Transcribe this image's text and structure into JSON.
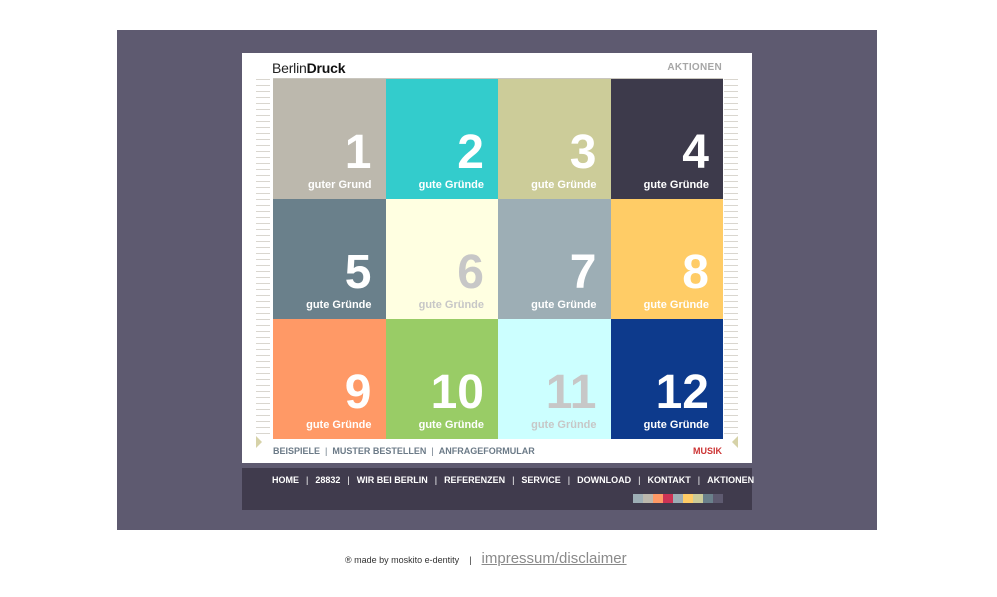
{
  "header": {
    "logo_light": "Berlin",
    "logo_bold": "Druck",
    "top_right_link": "AKTIONEN"
  },
  "tiles": [
    {
      "number": "1",
      "label": "guter Grund",
      "bg": "#bcb8ad",
      "text_color": "#ffffff"
    },
    {
      "number": "2",
      "label": "gute Gründe",
      "bg": "#33cccc",
      "text_color": "#ffffff"
    },
    {
      "number": "3",
      "label": "gute Gründe",
      "bg": "#cccc99",
      "text_color": "#ffffff"
    },
    {
      "number": "4",
      "label": "gute Gründe",
      "bg": "#3d3a4b",
      "text_color": "#ffffff"
    },
    {
      "number": "5",
      "label": "gute Gründe",
      "bg": "#6a808b",
      "text_color": "#ffffff"
    },
    {
      "number": "6",
      "label": "gute Gründe",
      "bg": "#ffffe1",
      "text_color": "#c7c7c7"
    },
    {
      "number": "7",
      "label": "gute Gründe",
      "bg": "#9daeb5",
      "text_color": "#ffffff"
    },
    {
      "number": "8",
      "label": "gute Gründe",
      "bg": "#ffcc66",
      "text_color": "#ffffff"
    },
    {
      "number": "9",
      "label": "gute Gründe",
      "bg": "#ff9966",
      "text_color": "#ffffff"
    },
    {
      "number": "10",
      "label": "gute Gründe",
      "bg": "#99cc66",
      "text_color": "#ffffff"
    },
    {
      "number": "11",
      "label": "gute Gründe",
      "bg": "#ccffff",
      "text_color": "#c7c7c7"
    },
    {
      "number": "12",
      "label": "gute Gründe",
      "bg": "#0d3a8c",
      "text_color": "#ffffff"
    }
  ],
  "subnav": {
    "items": [
      "BEISPIELE",
      "MUSTER BESTELLEN",
      "ANFRAGEFORMULAR"
    ],
    "right_link": "MUSIK"
  },
  "mainnav": {
    "items": [
      "HOME",
      "28832",
      "WIR BEI BERLIN",
      "REFERENZEN",
      "SERVICE",
      "DOWNLOAD",
      "KONTAKT",
      "AKTIONEN"
    ],
    "separator": "|"
  },
  "swatches": [
    "#9daeb5",
    "#bcb8ad",
    "#ff9966",
    "#cc3355",
    "#9daeb5",
    "#ffcc66",
    "#cccc99",
    "#6a808b",
    "#5e5a70"
  ],
  "footer": {
    "credit": "® made by moskito e-dentity",
    "separator": "|",
    "link": "impressum/disclaimer"
  }
}
